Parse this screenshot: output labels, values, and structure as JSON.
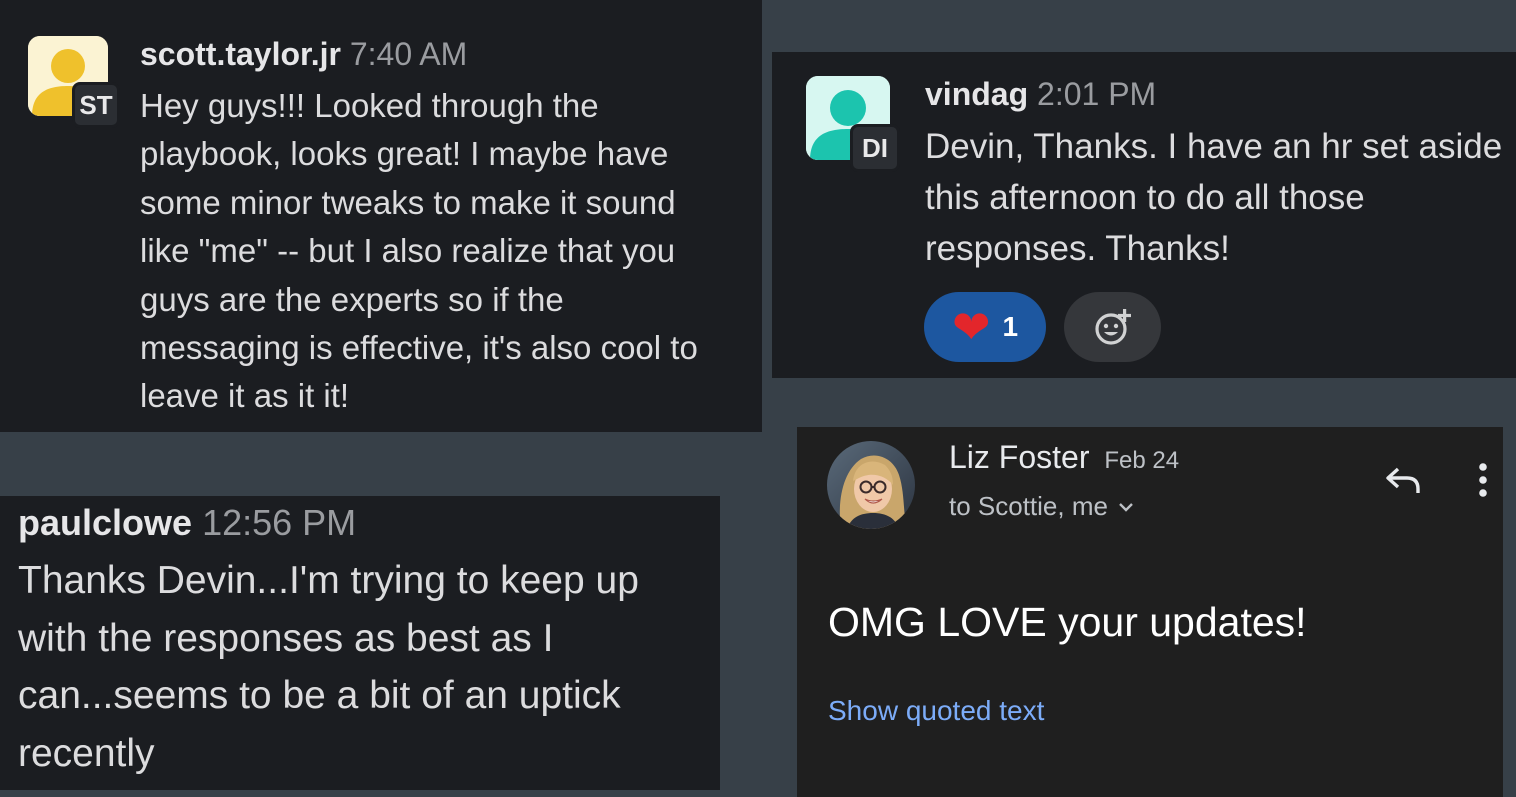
{
  "messages": [
    {
      "initials": "ST",
      "username": "scott.taylor.jr",
      "time": "7:40 AM",
      "lines": [
        "Hey guys!!! Looked through the",
        "playbook, looks great! I maybe have",
        "some minor tweaks to make it sound",
        "like \"me\" -- but I also realize that you",
        "guys are the experts so if the",
        "messaging is effective, it's also cool to",
        "leave it as it it!"
      ],
      "avatar_color": "#efc12c"
    },
    {
      "initials": "DI",
      "username": "vindag",
      "time": "2:01 PM",
      "lines": [
        "Devin, Thanks. I have an hr set aside",
        "this afternoon to do all those",
        "responses. Thanks!"
      ],
      "avatar_color": "#1cc4ae",
      "reactions": [
        {
          "icon": "heart-icon",
          "emoji": "❤",
          "count": "1"
        },
        {
          "icon": "add-reaction-icon"
        }
      ]
    },
    {
      "username": "paulclowe",
      "time": "12:56 PM",
      "lines": [
        "Thanks Devin...I'm trying to keep up",
        "with the responses as best as I",
        "can...seems to be a bit of an uptick",
        "recently"
      ]
    }
  ],
  "email": {
    "sender": "Liz Foster",
    "date": "Feb 24",
    "recipients": "to Scottie, me",
    "body": "OMG LOVE your updates!",
    "show_quoted": "Show quoted text",
    "link_color": "#7cacf8",
    "icons": [
      "chevron-down-icon",
      "reply-icon",
      "more-vert-icon"
    ]
  }
}
